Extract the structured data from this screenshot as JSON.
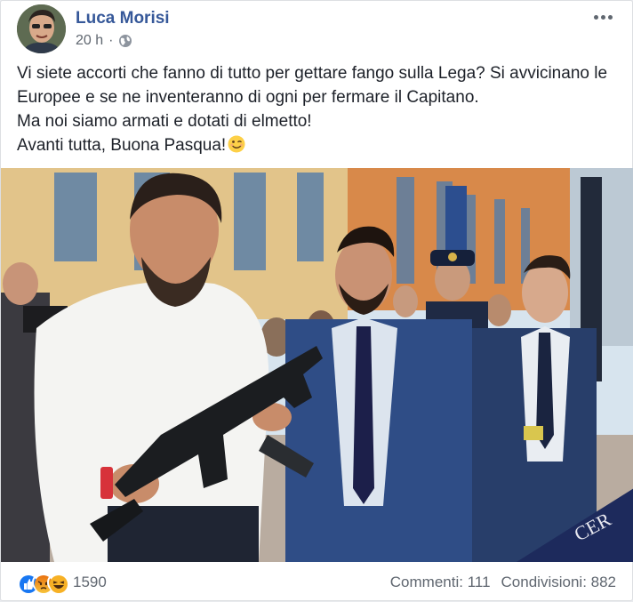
{
  "post": {
    "author": "Luca Morisi",
    "time": "20 h",
    "separator": "·",
    "privacy_icon": "globe-icon",
    "more_icon": "more-options-icon",
    "text_lines": [
      "Vi siete accorti che fanno di tutto per gettare fango sulla Lega? Si avvicinano le",
      "Europee e se ne inventeranno di ogni per fermare il Capitano.",
      "Ma noi siamo armati e dotati di elmetto!",
      "Avanti tutta, Buona Pasqua!"
    ],
    "end_emoji": "winking-face-emoji"
  },
  "footer": {
    "reaction_icons": [
      "like-icon",
      "angry-icon",
      "haha-icon"
    ],
    "reaction_count": "1590",
    "comments": "Commenti: 111",
    "shares": "Condivisioni: 882"
  },
  "colors": {
    "author_link": "#365899",
    "meta_text": "#606770",
    "like_blue": "#1877f2",
    "angry_red": "#e9710f",
    "haha_yellow": "#f7b125"
  }
}
